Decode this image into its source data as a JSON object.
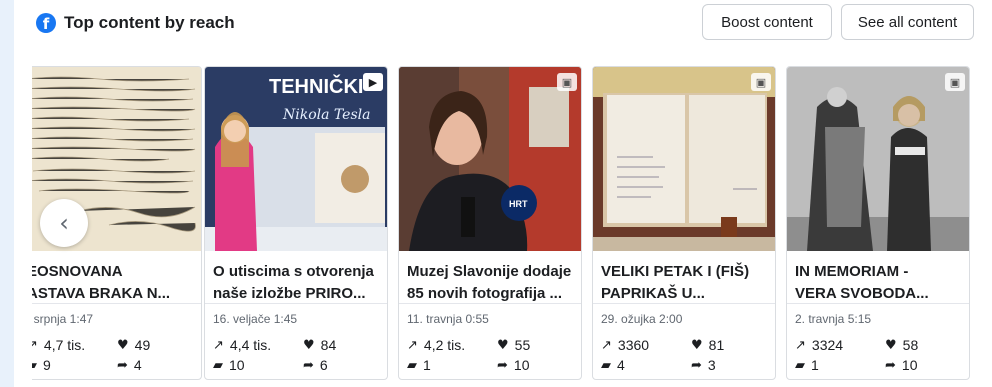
{
  "header": {
    "icon": "facebook-icon",
    "title": "Top content by reach"
  },
  "buttons": {
    "boost": "Boost content",
    "see_all": "See all content"
  },
  "cards": [
    {
      "title": "EOSNOVANA\nASTAVA BRAKA N...",
      "date": ". srpnja 1:47",
      "reach": "4,7 tis.",
      "likes": "49",
      "comments": "9",
      "shares": "4"
    },
    {
      "title": "O utiscima s otvorenja\nnaše izložbe PRIRO...",
      "date": "16. veljače 1:45",
      "reach": "4,4 tis.",
      "likes": "84",
      "comments": "10",
      "shares": "6",
      "badge": "video-icon",
      "image_text": "TEHNIČKI"
    },
    {
      "title": "Muzej Slavonije dodaje\n85 novih fotografija ...",
      "date": "11. travnja 0:55",
      "reach": "4,2 tis.",
      "likes": "55",
      "comments": "1",
      "shares": "10",
      "badge": "photo-icon"
    },
    {
      "title": "VELIKI PETAK I (FIŠ)\nPAPRIKAŠ U...",
      "date": "29. ožujka 2:00",
      "reach": "3360",
      "likes": "81",
      "comments": "4",
      "shares": "3",
      "badge": "photo-icon"
    },
    {
      "title": "IN MEMORIAM -\nVERA SVOBODA...",
      "date": "2. travnja 5:15",
      "reach": "3324",
      "likes": "58",
      "comments": "1",
      "shares": "10",
      "badge": "photo-icon"
    }
  ],
  "carousel": {
    "prev_icon": "chevron-left-icon"
  }
}
